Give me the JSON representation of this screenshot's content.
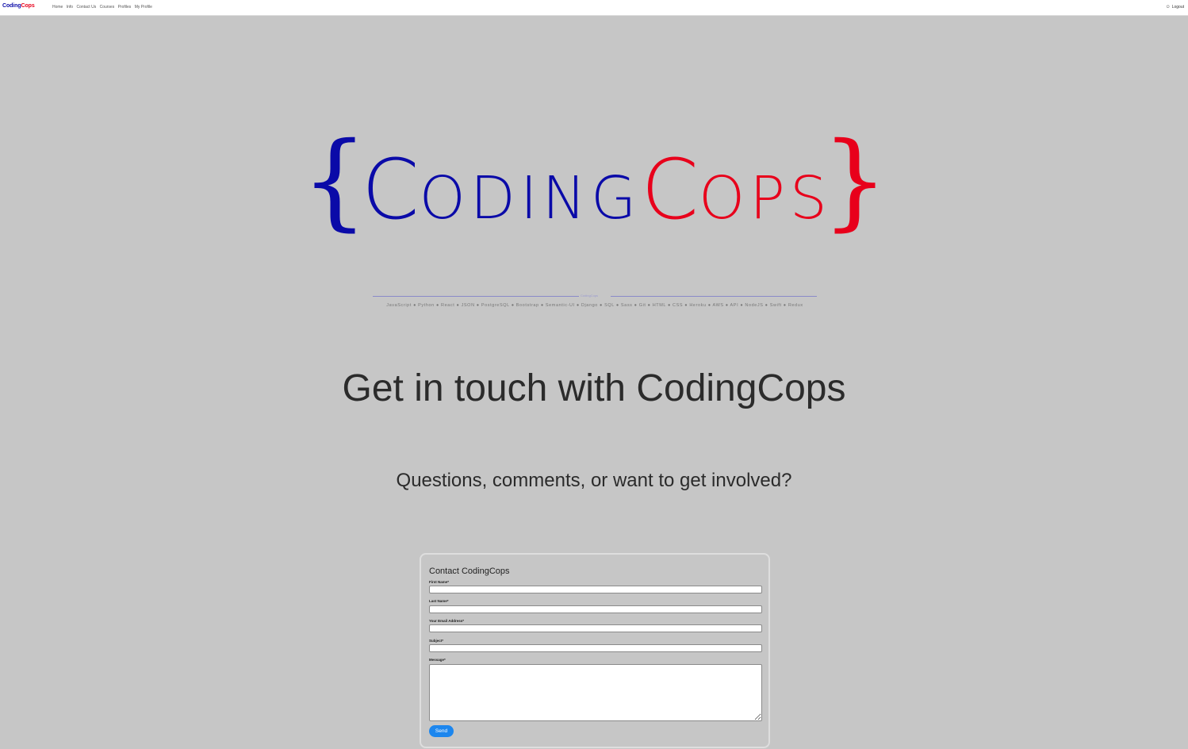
{
  "nav": {
    "brand": {
      "part1": "Coding",
      "part2": "Cops"
    },
    "links": [
      "Home",
      "Info",
      "Contact Us",
      "Courses",
      "Profiles",
      "My Profile"
    ],
    "logout_label": "Logout"
  },
  "logo": {
    "brace_left": "{",
    "brace_right": "}",
    "word1_initial": "C",
    "word1_rest": "ODING",
    "word2_initial": "C",
    "word2_rest": "OPS"
  },
  "divider": {
    "label": "CodingCops",
    "tech_list": "JavaScript ● Python ● React ● JSON ● PostgreSQL ● Bootstrap ● Semantic-UI ● Django ● SQL ● Sass ● Git ● HTML ● CSS ● Heroku ● AWS ● API ● NodeJS ● Swift ● Redux"
  },
  "hero": {
    "headline": "Get in touch with CodingCops",
    "subline": "Questions, comments, or want to get involved?"
  },
  "form": {
    "title": "Contact CodingCops",
    "first_name_label": "First Name*",
    "last_name_label": "Last Name*",
    "email_label": "Your Email Address*",
    "subject_label": "Subject*",
    "message_label": "Message*",
    "first_name_value": "",
    "last_name_value": "",
    "email_value": "",
    "subject_value": "",
    "message_value": "",
    "send_label": "Send"
  },
  "colors": {
    "brand_blue": "#0a0aa8",
    "brand_red": "#e8001b",
    "page_bg": "#c6c6c6",
    "send_button": "#1c86ee"
  },
  "icons": {
    "logout": "user-icon"
  }
}
